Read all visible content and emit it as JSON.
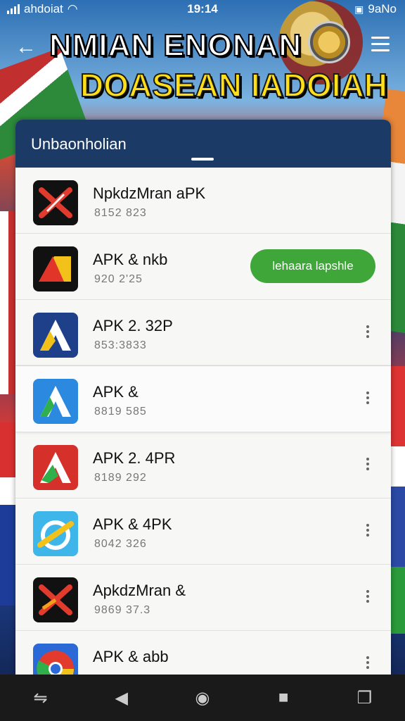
{
  "status": {
    "carrier": "ahdoiat",
    "time": "19:14",
    "battery": "9aNo"
  },
  "header": {
    "title_line1": "NMIAN ENONAN",
    "title_line2": "DOASEAN IADOIAH"
  },
  "panel": {
    "title": "Unbaonholian"
  },
  "apps": [
    {
      "name": "NpkdzMran aPK",
      "sub": "8152 823",
      "icon": "red-x-icon",
      "action": "none"
    },
    {
      "name": "APK & nkb",
      "sub": "920 2'25",
      "icon": "red-arrow-icon",
      "action": "install",
      "action_label": "lehaara lapshle"
    },
    {
      "name": "APK 2. 32P",
      "sub": "853:3833",
      "icon": "a-logo-navy-icon",
      "action": "menu"
    },
    {
      "name": "APK &",
      "sub": "8819 585",
      "icon": "a-logo-blue-icon",
      "action": "menu"
    },
    {
      "name": "APK 2. 4PR",
      "sub": "8189 292",
      "icon": "a-logo-red-icon",
      "action": "menu"
    },
    {
      "name": "APK & 4PK",
      "sub": "8042 326",
      "icon": "a-logo-cyan-icon",
      "action": "menu"
    },
    {
      "name": "ApkdzMran &",
      "sub": "9869 37.3",
      "icon": "red-x-dark-icon",
      "action": "menu"
    },
    {
      "name": "APK & abb",
      "sub": "",
      "icon": "chrome-like-icon",
      "action": "menu"
    }
  ],
  "colors": {
    "panel_header": "#1c3a66",
    "install_button": "#3fa63a",
    "title_yellow": "#ffde1a"
  }
}
